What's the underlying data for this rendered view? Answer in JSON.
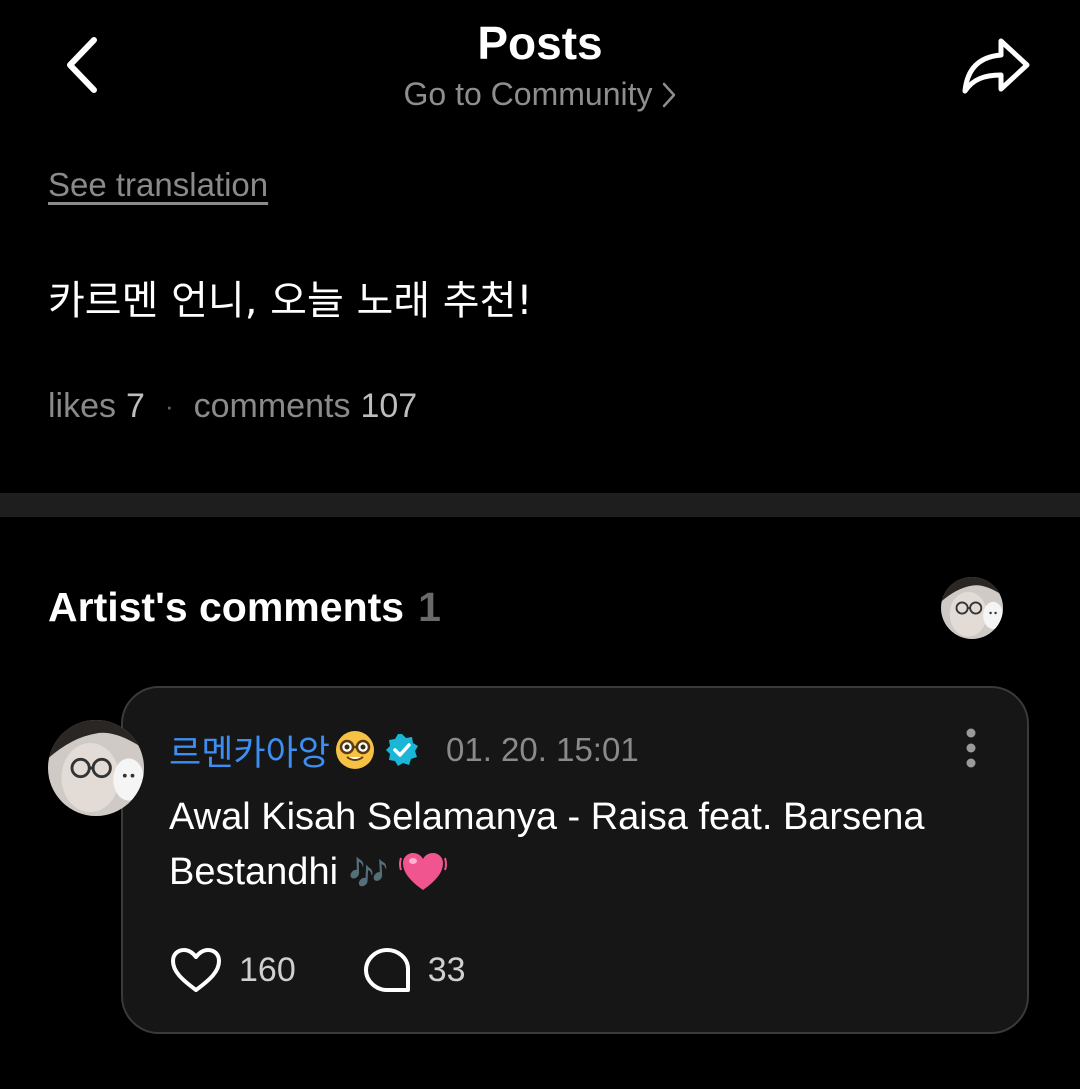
{
  "header": {
    "title": "Posts",
    "community_link": "Go to Community"
  },
  "post": {
    "see_translation": "See translation",
    "text": "카르멘 언니, 오늘 노래 추천!",
    "likes_label": "likes",
    "likes_count": "7",
    "comments_label": "comments",
    "comments_count": "107"
  },
  "artist_comments": {
    "heading": "Artist's comments",
    "count": "1"
  },
  "comment": {
    "author": "르멘카아앙",
    "timestamp": "01. 20. 15:01",
    "body": "Awal Kisah Selamanya - Raisa feat. Barsena Bestandhi",
    "body_emojis": "🎶",
    "likes": "160",
    "replies": "33"
  },
  "icons": {
    "back": "chevron-left-icon",
    "share": "share-arrow-icon",
    "community_chevron": "chevron-right-icon",
    "author_emoji": "nerd-face-emoji-icon",
    "verified": "verified-badge-icon",
    "more": "more-vertical-icon",
    "heart_emoji": "beating-heart-emoji-icon",
    "like": "heart-outline-icon",
    "reply": "speech-bubble-icon"
  },
  "colors": {
    "background": "#000000",
    "accent": "#3d8ef2",
    "verified": "#19b6d8",
    "card": "#161616",
    "muted": "#8a8a8a"
  }
}
